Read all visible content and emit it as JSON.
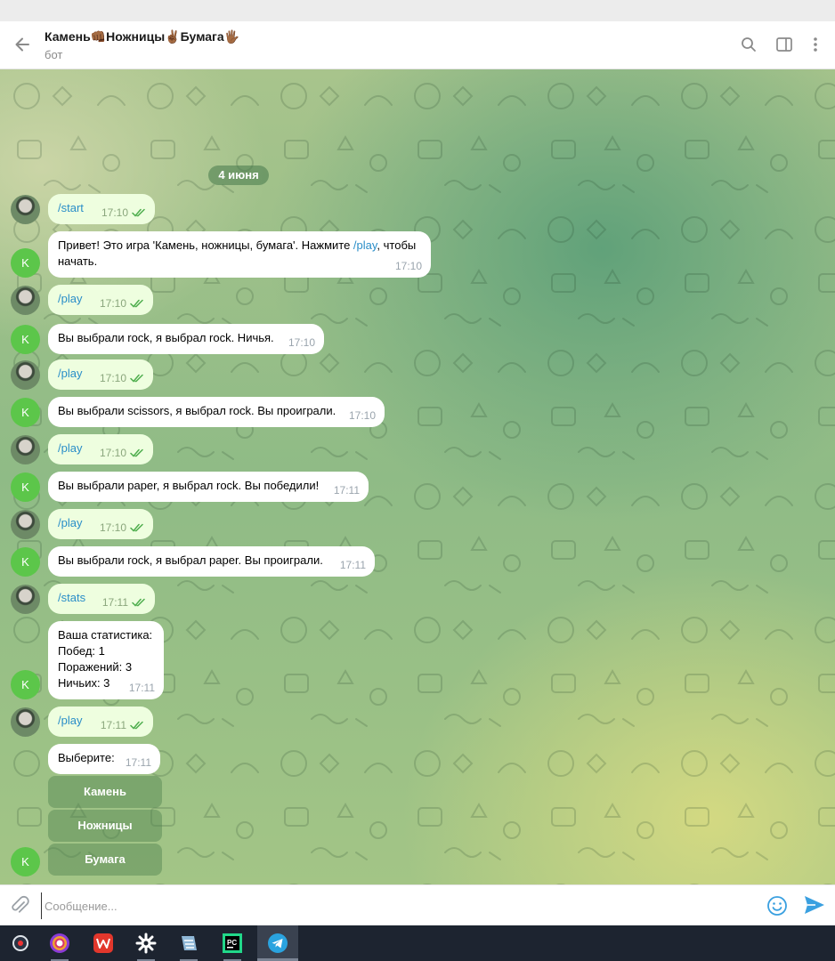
{
  "header": {
    "title": "Камень👊🏾Ножницы✌🏾Бумага🖐🏾",
    "subtitle": "бот",
    "icons": [
      "back-arrow-icon",
      "search-icon",
      "sidebar-toggle-icon",
      "more-menu-icon"
    ]
  },
  "chat": {
    "date": "4 июня",
    "bot_initial": "K",
    "messages": [
      {
        "from": "user",
        "command": "/start",
        "time": "17:10",
        "read": true
      },
      {
        "from": "bot",
        "text_before": "Привет! Это игра 'Камень, ножницы, бумага'. Нажмите ",
        "link": "/play",
        "text_after": ", чтобы начать.",
        "time": "17:10"
      },
      {
        "from": "user",
        "command": "/play",
        "time": "17:10",
        "read": true
      },
      {
        "from": "bot",
        "text": "Вы выбрали rock, я выбрал rock. Ничья.",
        "time": "17:10"
      },
      {
        "from": "user",
        "command": "/play",
        "time": "17:10",
        "read": true
      },
      {
        "from": "bot",
        "text": "Вы выбрали scissors, я выбрал rock. Вы проиграли.",
        "time": "17:10"
      },
      {
        "from": "user",
        "command": "/play",
        "time": "17:10",
        "read": true
      },
      {
        "from": "bot",
        "text": "Вы выбрали paper, я выбрал rock. Вы победили!",
        "time": "17:11"
      },
      {
        "from": "user",
        "command": "/play",
        "time": "17:10",
        "read": true
      },
      {
        "from": "bot",
        "text": "Вы выбрали rock, я выбрал paper. Вы проиграли.",
        "time": "17:11"
      },
      {
        "from": "user",
        "command": "/stats",
        "time": "17:11",
        "read": true
      },
      {
        "from": "bot",
        "lines": [
          "Ваша статистика:",
          "Побед: 1",
          "Поражений: 3",
          "Ничьих: 3"
        ],
        "time": "17:11"
      },
      {
        "from": "user",
        "command": "/play",
        "time": "17:11",
        "read": true
      },
      {
        "from": "bot",
        "text": "Выберите:",
        "time": "17:11"
      }
    ],
    "keyboard": [
      "Камень",
      "Ножницы",
      "Бумага"
    ]
  },
  "composer": {
    "placeholder": "Сообщение...",
    "icons": [
      "attach-icon",
      "emoji-icon",
      "send-icon"
    ]
  },
  "taskbar": {
    "apps": [
      "app-menu-icon",
      "browser-icon",
      "office-icon",
      "settings-icon",
      "notes-icon",
      "pycharm-icon",
      "telegram-icon"
    ],
    "pycharm_badge": "PC"
  },
  "colors": {
    "link": "#2a8ec8",
    "outgoing_bubble": "#eefedf",
    "bot_avatar": "#5cc64a",
    "read_check": "#4fae4e"
  }
}
